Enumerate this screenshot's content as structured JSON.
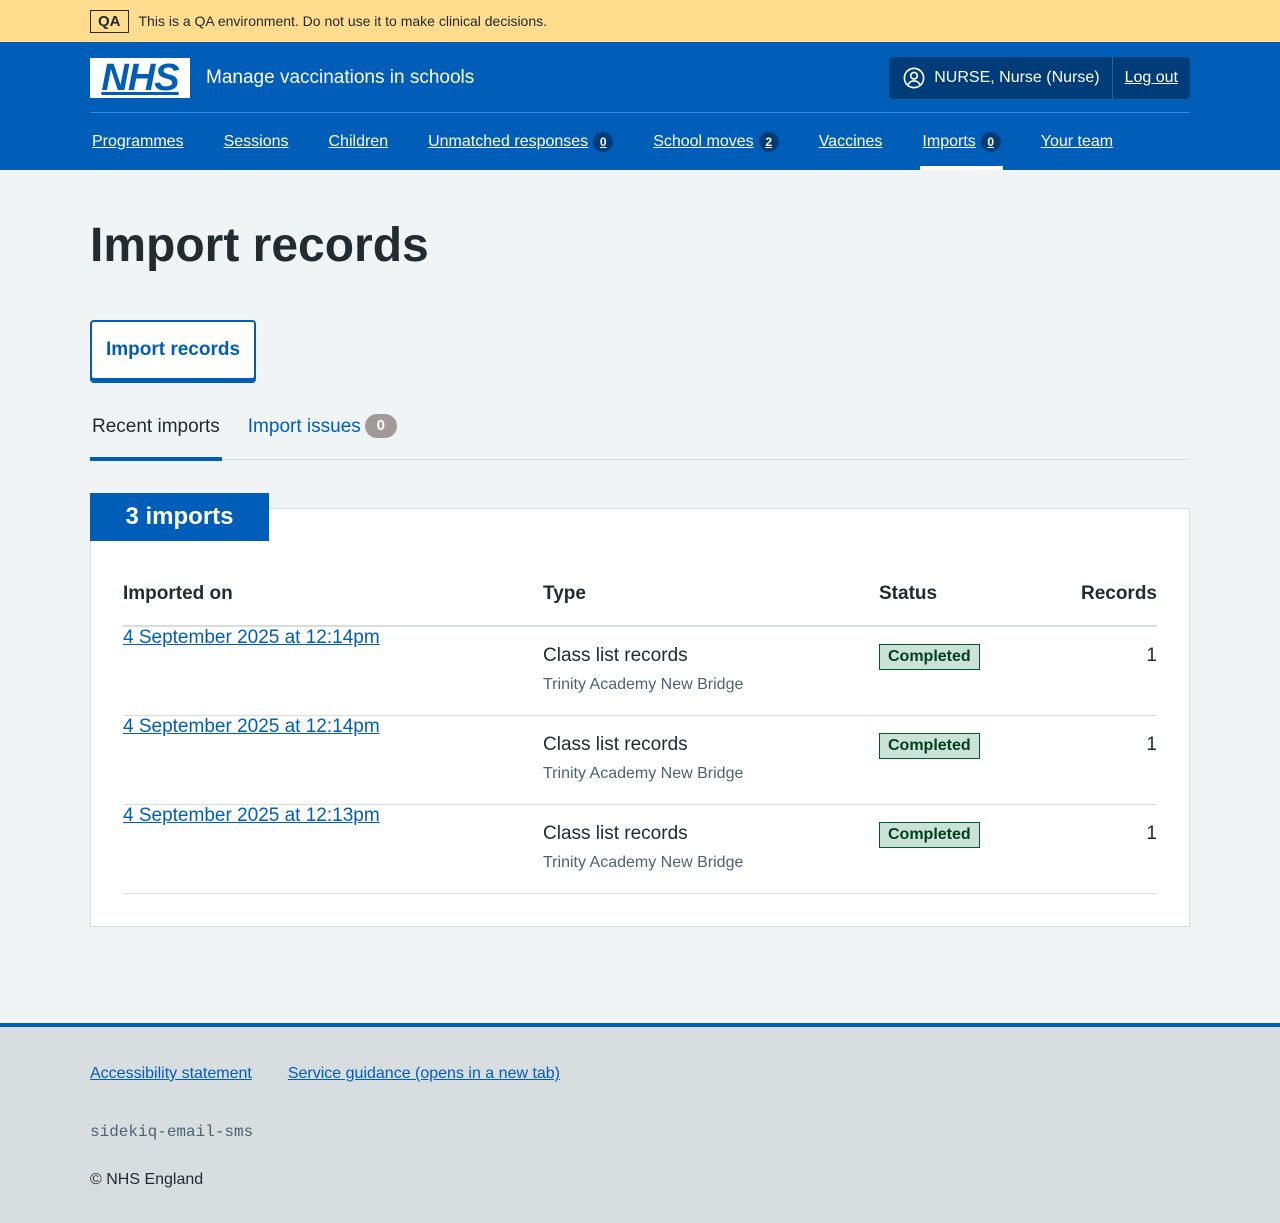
{
  "qa_banner": {
    "tag": "QA",
    "message": "This is a QA environment. Do not use it to make clinical decisions."
  },
  "header": {
    "logo_text": "NHS",
    "service_name": "Manage vaccinations in schools",
    "user": "NURSE, Nurse (Nurse)",
    "logout": "Log out",
    "nav": [
      {
        "label": "Programmes"
      },
      {
        "label": "Sessions"
      },
      {
        "label": "Children"
      },
      {
        "label": "Unmatched responses",
        "count": "0"
      },
      {
        "label": "School moves",
        "count": "2"
      },
      {
        "label": "Vaccines"
      },
      {
        "label": "Imports",
        "count": "0",
        "active": true
      },
      {
        "label": "Your team"
      }
    ]
  },
  "main": {
    "title": "Import records",
    "import_button": "Import records",
    "tabs": [
      {
        "label": "Recent imports",
        "selected": true
      },
      {
        "label": "Import issues",
        "count": "0"
      }
    ],
    "card_heading": "3 imports",
    "table": {
      "headers": [
        "Imported on",
        "Type",
        "Status",
        "Records"
      ],
      "rows": [
        {
          "date": "4 September 2025 at 12:14pm",
          "type": "Class list records",
          "school": "Trinity Academy New Bridge",
          "status": "Completed",
          "records": "1"
        },
        {
          "date": "4 September 2025 at 12:14pm",
          "type": "Class list records",
          "school": "Trinity Academy New Bridge",
          "status": "Completed",
          "records": "1"
        },
        {
          "date": "4 September 2025 at 12:13pm",
          "type": "Class list records",
          "school": "Trinity Academy New Bridge",
          "status": "Completed",
          "records": "1"
        }
      ]
    }
  },
  "footer": {
    "links": [
      "Accessibility statement",
      "Service guidance (opens in a new tab)"
    ],
    "env": "sidekiq-email-sms",
    "copyright": "© NHS England"
  },
  "colors": {
    "nhs_blue": "#005eb8",
    "qa_yellow": "#ffdc8e",
    "status_green_bg": "#cce2d8"
  }
}
